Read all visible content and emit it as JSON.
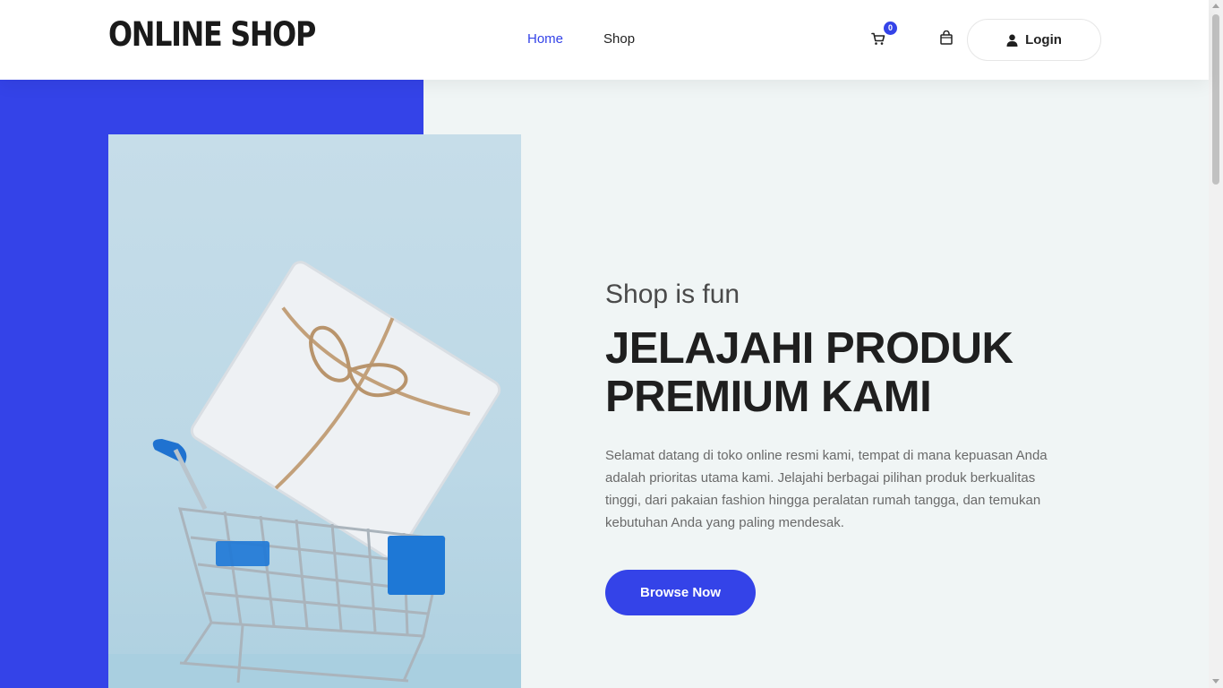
{
  "header": {
    "logo": "ONLINE SHOP",
    "nav": [
      {
        "label": "Home",
        "active": true
      },
      {
        "label": "Shop",
        "active": false
      }
    ],
    "cart_count": "0",
    "login_label": "Login"
  },
  "hero": {
    "subtitle": "Shop is fun",
    "headline_line1": "JELAJAHI PRODUK",
    "headline_line2": "PREMIUM KAMI",
    "description": "Selamat datang di toko online resmi kami, tempat di mana kepuasan Anda adalah prioritas utama kami. Jelajahi berbagai pilihan produk berkualitas tinggi, dari pakaian fashion hingga peralatan rumah tangga, dan temukan kebutuhan Anda yang paling mendesak.",
    "cta_label": "Browse Now"
  },
  "icons": {
    "cart": "cart-icon",
    "bag": "shopping-bag-icon",
    "user": "user-icon"
  },
  "colors": {
    "accent": "#3443e8",
    "background": "#f0f5f5"
  }
}
